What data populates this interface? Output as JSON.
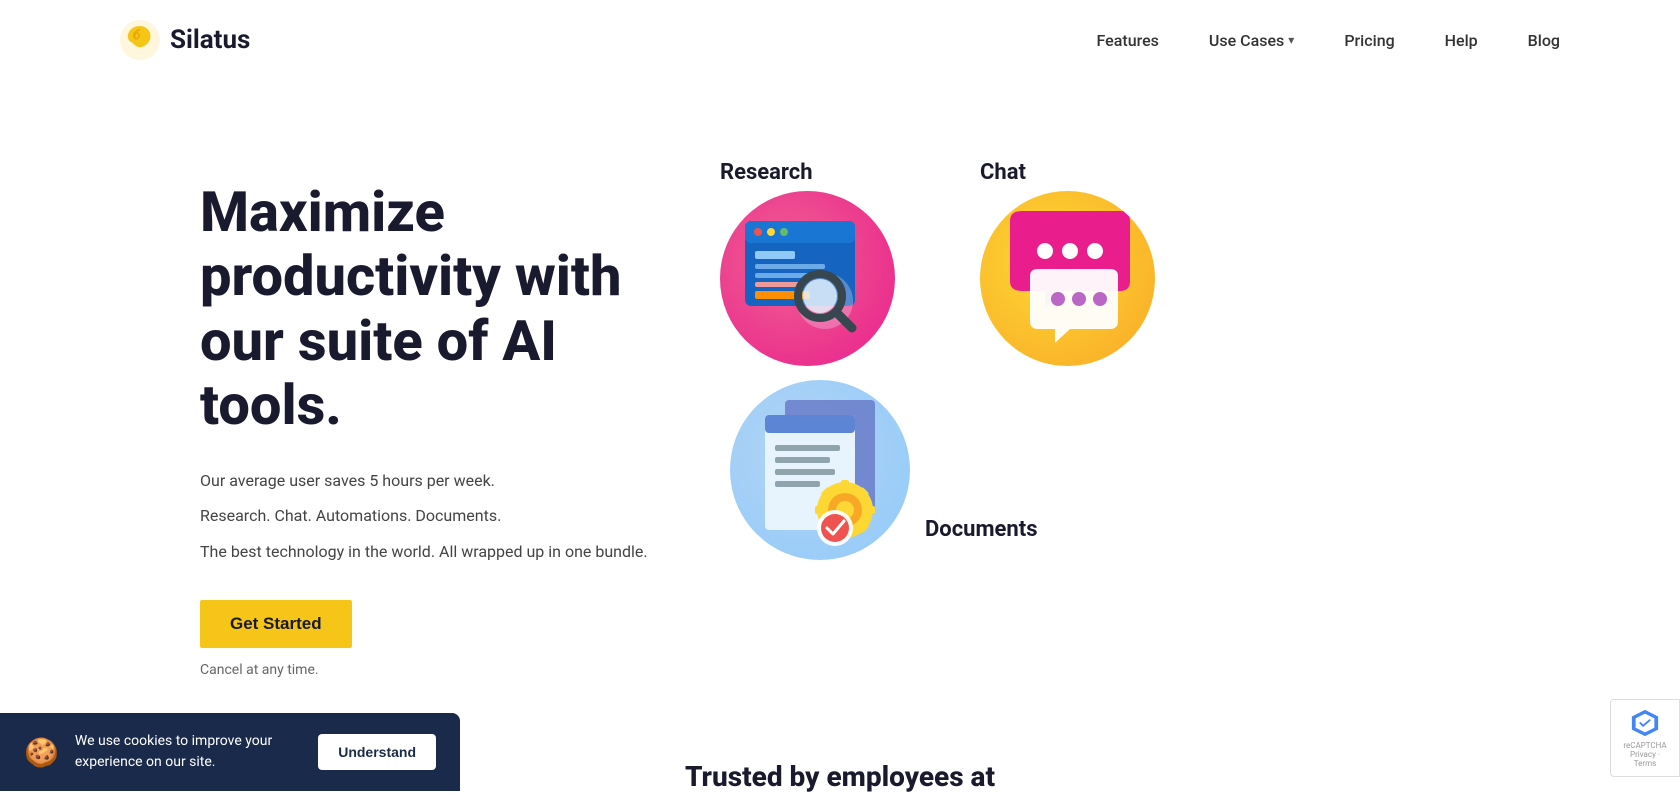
{
  "nav": {
    "logo_text": "Silatus",
    "links": [
      {
        "label": "Features",
        "id": "features"
      },
      {
        "label": "Use Cases",
        "id": "use-cases",
        "has_dropdown": true
      },
      {
        "label": "Pricing",
        "id": "pricing"
      },
      {
        "label": "Help",
        "id": "help"
      },
      {
        "label": "Blog",
        "id": "blog"
      }
    ]
  },
  "hero": {
    "title": "Maximize productivity with our suite of AI tools.",
    "subtitle1": "Our average user saves 5 hours per week.",
    "subtitle2": "Research. Chat. Automations. Documents.",
    "subtitle3": "The best technology in the world. All wrapped up in one bundle.",
    "cta_label": "Get Started",
    "cancel_note": "Cancel at any time."
  },
  "illustrations": [
    {
      "id": "research",
      "label": "Research"
    },
    {
      "id": "chat",
      "label": "Chat"
    },
    {
      "id": "documents",
      "label": "Documents"
    }
  ],
  "cookie": {
    "text": "We use cookies to improve your experience on our site.",
    "button_label": "Understand",
    "icon": "🍪"
  },
  "bottom": {
    "heading": "Trusted by employees at"
  }
}
